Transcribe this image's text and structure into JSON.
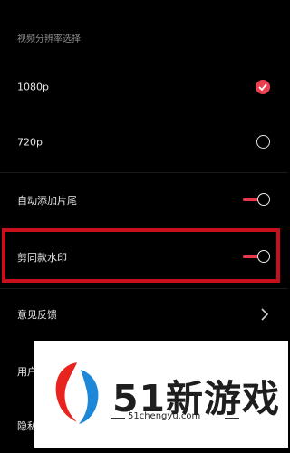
{
  "section_title": "视频分辨率选择",
  "items": [
    {
      "label": "1080p",
      "control": "check",
      "selected": true
    },
    {
      "label": "720p",
      "control": "radio",
      "selected": false
    },
    {
      "label": "自动添加片尾",
      "control": "toggle",
      "on": true
    },
    {
      "label": "剪同款水印",
      "control": "toggle",
      "on": true
    },
    {
      "label": "意见反馈",
      "control": "chevron"
    },
    {
      "label": "用户",
      "control": "none"
    },
    {
      "label": "隐私",
      "control": "none"
    }
  ],
  "watermark": {
    "title": "51新游戏",
    "url": "51chengyu.com"
  },
  "colors": {
    "accent": "#ec3f52",
    "highlight": "#c8101d",
    "background": "#000000"
  }
}
